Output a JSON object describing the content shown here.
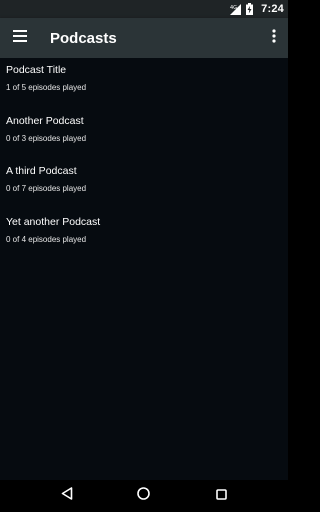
{
  "status_bar": {
    "time": "7:24",
    "icons": [
      "data-signal-icon",
      "battery-charging-icon"
    ]
  },
  "app_bar": {
    "title": "Podcasts",
    "menu_icon": "hamburger-menu-icon",
    "overflow_icon": "more-vert-icon"
  },
  "podcasts": [
    {
      "title": "Podcast Title",
      "subtitle": "1 of 5 episodes played"
    },
    {
      "title": "Another Podcast",
      "subtitle": "0 of 3 episodes played"
    },
    {
      "title": "A third Podcast",
      "subtitle": "0 of 7 episodes played"
    },
    {
      "title": "Yet another Podcast",
      "subtitle": "0 of 4 episodes played"
    }
  ],
  "nav_bar": {
    "icons": [
      "back-triangle-icon",
      "home-circle-icon",
      "recents-square-icon"
    ]
  },
  "colors": {
    "app_bar": "#2b3437",
    "status_bar": "#1f2426",
    "background": "#060b10"
  }
}
